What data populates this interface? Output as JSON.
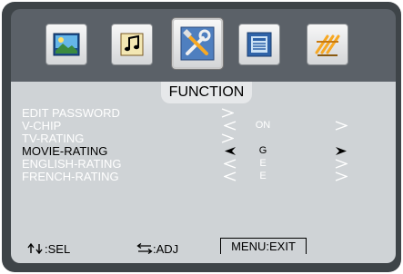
{
  "tabs": [
    {
      "name": "picture-icon"
    },
    {
      "name": "sound-icon"
    },
    {
      "name": "function-icon",
      "selected": true
    },
    {
      "name": "setup-icon"
    },
    {
      "name": "channel-icon"
    }
  ],
  "panel_title": "FUNCTION",
  "rows": [
    {
      "label": "EDIT PASSWORD",
      "value": ""
    },
    {
      "label": "V-CHIP",
      "value": "ON"
    },
    {
      "label": "TV-RATING",
      "value": ""
    },
    {
      "label": "MOVIE-RATING",
      "value": "G",
      "selected": true
    },
    {
      "label": "ENGLISH-RATING",
      "value": "E"
    },
    {
      "label": "FRENCH-RATING",
      "value": "E"
    }
  ],
  "hints": {
    "select": ":SEL",
    "adjust": ":ADJ",
    "menu": "MENU",
    "exit": ":EXIT"
  },
  "colors": {
    "frame": "#3e4448",
    "panel": "#cfd3d6",
    "text": "#ffffff",
    "selected_text": "#000000"
  }
}
